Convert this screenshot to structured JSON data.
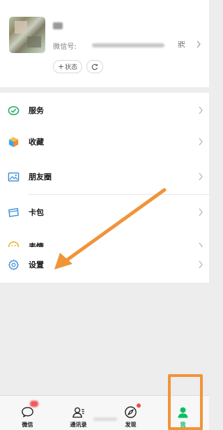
{
  "profile": {
    "wechat_id_label": "微信号:",
    "status_label": "状态",
    "status_plus": "+"
  },
  "menu": {
    "services": "服务",
    "favorites": "收藏",
    "moments": "朋友圈",
    "cards": "卡包",
    "stickers": "表情",
    "settings": "设置"
  },
  "tabbar": {
    "chats": "微信",
    "contacts": "通讯录",
    "discover": "发现",
    "me": "我"
  },
  "colors": {
    "wechat_green": "#07c160",
    "highlight_orange": "#f0943a",
    "badge_red": "#f24a4a",
    "background": "#ededed"
  },
  "icons": {
    "services": "wallet-check-icon",
    "favorites": "cube-icon",
    "moments": "picture-icon",
    "cards": "card-icon",
    "stickers": "smiley-icon",
    "settings": "gear-icon"
  }
}
